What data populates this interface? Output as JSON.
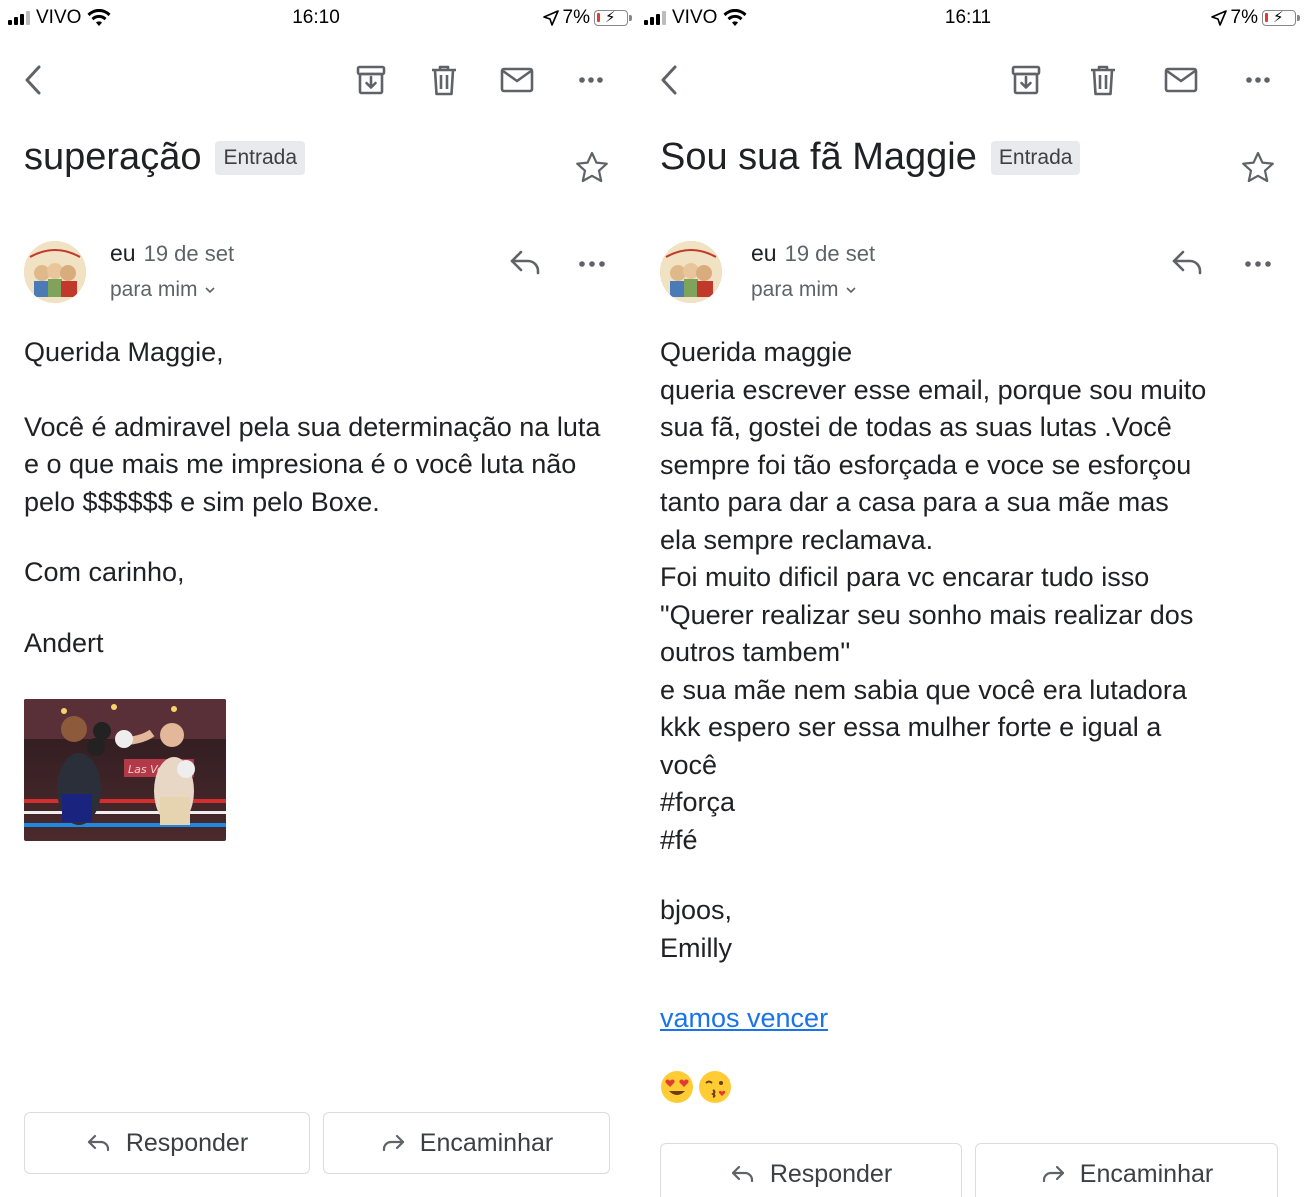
{
  "left": {
    "status": {
      "carrier": "VIVO",
      "time": "16:10",
      "battery": "7%"
    },
    "subject": "superação",
    "label": "Entrada",
    "sender": {
      "name": "eu",
      "date": "19 de set",
      "recipient": "para mim"
    },
    "body": {
      "greeting": "Querida Maggie,",
      "paragraph": " Você é admiravel pela sua determinação na luta e o que mais me impresiona é o você luta não pelo $$$$$$ e sim pelo Boxe.",
      "closing": "Com carinho,",
      "signature": "Andert"
    },
    "attachment": {
      "icon": "boxing-photo"
    },
    "actions": {
      "reply": "Responder",
      "forward": "Encaminhar"
    }
  },
  "right": {
    "status": {
      "carrier": "VIVO",
      "time": "16:11",
      "battery": "7%"
    },
    "subject": "Sou sua fã Maggie",
    "label": "Entrada",
    "sender": {
      "name": "eu",
      "date": "19 de set",
      "recipient": "para mim"
    },
    "body": {
      "text": "Querida maggie\nqueria escrever esse email, porque  sou muito\nsua fã, gostei de todas as suas lutas .Você\nsempre foi tão esforçada e voce se esforçou\ntanto para  dar a casa  para a sua mãe  mas\nela sempre reclamava.\nFoi muito  dificil para vc encarar tudo isso\n\"Querer realizar seu sonho mais realizar dos\noutros tambem''\ne sua mãe nem sabia que você era lutadora\nkkk espero ser essa mulher  forte e igual a\nvocê\n#força\n#fé",
      "closing": "bjoos,\nEmilly",
      "link": "vamos vencer",
      "emojis": [
        "heart-eyes-emoji",
        "kissing-wink-emoji"
      ]
    },
    "actions": {
      "reply": "Responder",
      "forward": "Encaminhar"
    }
  }
}
